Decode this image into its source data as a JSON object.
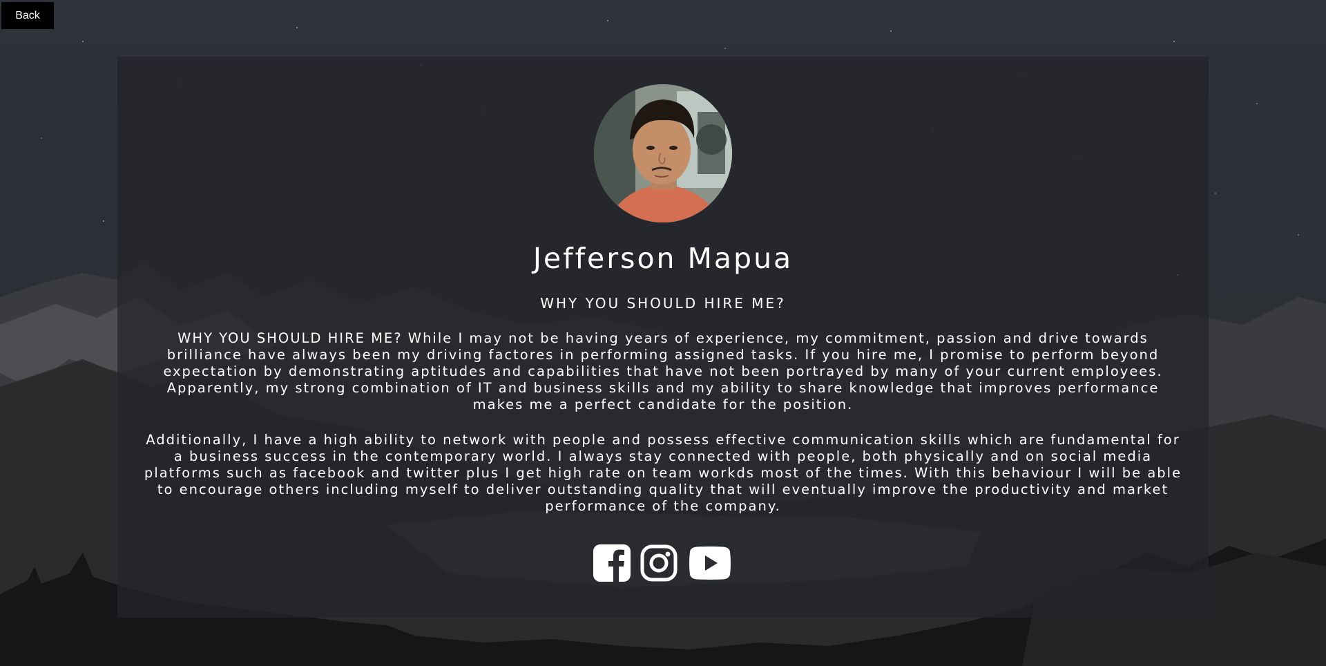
{
  "page": {
    "back_label": "Back"
  },
  "profile": {
    "name": "Jefferson Mapua",
    "subtitle": "WHY YOU SHOULD HIRE ME?",
    "paragraphs": [
      "WHY YOU SHOULD HIRE ME? While I may not be having years of experience, my commitment, passion and drive towards brilliance have always been my driving factores in performing assigned tasks. If you hire me, I promise to perform beyond expectation by demonstrating aptitudes and capabilities that have not been portrayed by many of your current employees. Apparently, my strong combination of IT and business skills and my ability to share knowledge that improves performance makes me a perfect candidate for the position.",
      "Additionally, I have a high ability to network with people and possess effective communication skills which are fundamental for a business success in the contemporary world. I always stay connected with people, both physically and on social media platforms such as facebook and twitter plus I get high rate on team workds most of the times. With this behaviour I will be able to encourage others including myself to deliver outstanding quality that will eventually improve the productivity and market performance of the company."
    ]
  },
  "socials": [
    {
      "icon": "facebook-icon"
    },
    {
      "icon": "instagram-icon"
    },
    {
      "icon": "youtube-icon"
    }
  ],
  "colors": {
    "card_bg": "#222428",
    "text": "#ffffff",
    "button_bg": "#000000"
  }
}
